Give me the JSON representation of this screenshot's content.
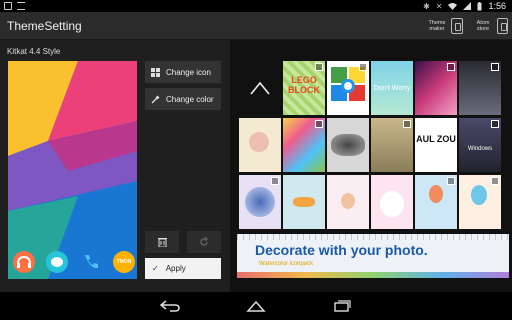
{
  "status_bar": {
    "time": "1:56",
    "left_icons": [
      "screenshot-icon",
      "download-icon"
    ],
    "right_icons": [
      "bluetooth-icon",
      "mute-icon",
      "wifi-icon",
      "signal-icon",
      "battery-icon"
    ]
  },
  "action_bar": {
    "title": "ThemeSetting",
    "theme_maker_label": "Theme maker",
    "atom_store_label": "Atom store"
  },
  "left_pane": {
    "style_label": "Kitkat 4.4 Style",
    "change_icon_label": "Change icon",
    "change_color_label": "Change color",
    "apply_label": "Apply",
    "dock_apps": [
      "music-app-icon",
      "messenger-app-icon",
      "phone-app-icon",
      "tmon-app-icon"
    ],
    "dock_app_text": "TMON"
  },
  "grid": {
    "tiles": [
      {
        "name": "lego-block-theme",
        "text": "LEGO BLOCK"
      },
      {
        "name": "rainbow-tile-theme",
        "text": ""
      },
      {
        "name": "dont-worry-theme",
        "text": "Don't Worry"
      },
      {
        "name": "pink-space-theme",
        "text": ""
      },
      {
        "name": "dark-night-theme",
        "text": ""
      },
      {
        "name": "flower-sketch-theme",
        "text": ""
      },
      {
        "name": "colorful-doodle-theme",
        "text": ""
      },
      {
        "name": "flower-photo-theme",
        "text": ""
      },
      {
        "name": "vintage-theme",
        "text": ""
      },
      {
        "name": "black-white-letters-theme",
        "text": "AUL ZOU"
      },
      {
        "name": "windows-theme",
        "text": "Windows"
      },
      {
        "name": "blue-badge-theme",
        "text": ""
      },
      {
        "name": "birds-theme",
        "text": ""
      },
      {
        "name": "girl-cartoon-theme",
        "text": ""
      },
      {
        "name": "bunny-theme",
        "text": ""
      },
      {
        "name": "balloon-theme",
        "text": ""
      },
      {
        "name": "balloon-pastel-theme",
        "text": ""
      }
    ]
  },
  "banner": {
    "title": "Decorate with your photo.",
    "subtitle": "Watercolor iconpack"
  },
  "colors": {
    "accent": "#1a5aa8",
    "background": "#111111",
    "panel": "#1f1f1f",
    "action_bar": "#2b2b2b"
  }
}
